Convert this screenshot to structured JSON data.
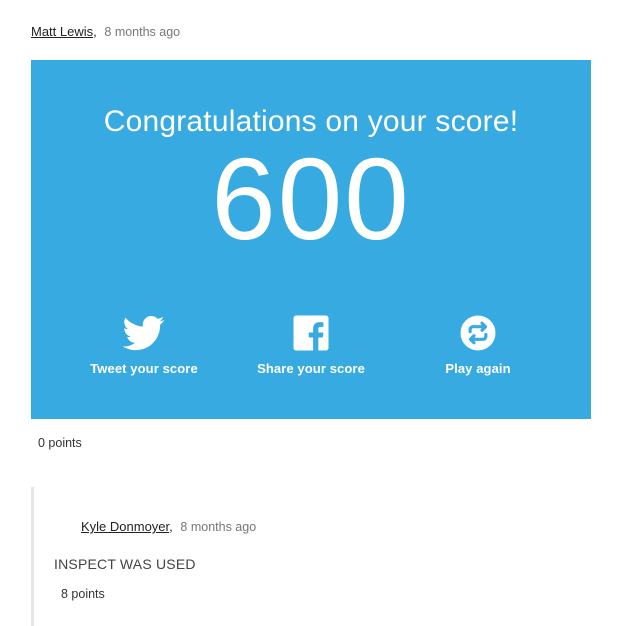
{
  "comment": {
    "author": "Matt Lewis",
    "separator": ",",
    "time": "8 months ago",
    "points": "0 points"
  },
  "score_card": {
    "heading": "Congratulations on your score!",
    "score": "600",
    "background": "#37abe1",
    "actions": [
      {
        "label": "Tweet your score",
        "icon": "twitter-icon"
      },
      {
        "label": "Share your score",
        "icon": "facebook-icon"
      },
      {
        "label": "Play again",
        "icon": "replay-icon"
      }
    ]
  },
  "reply": {
    "author": "Kyle Donmoyer",
    "separator": ",",
    "time": "8 months ago",
    "body": "INSPECT WAS USED",
    "points": "8 points"
  }
}
